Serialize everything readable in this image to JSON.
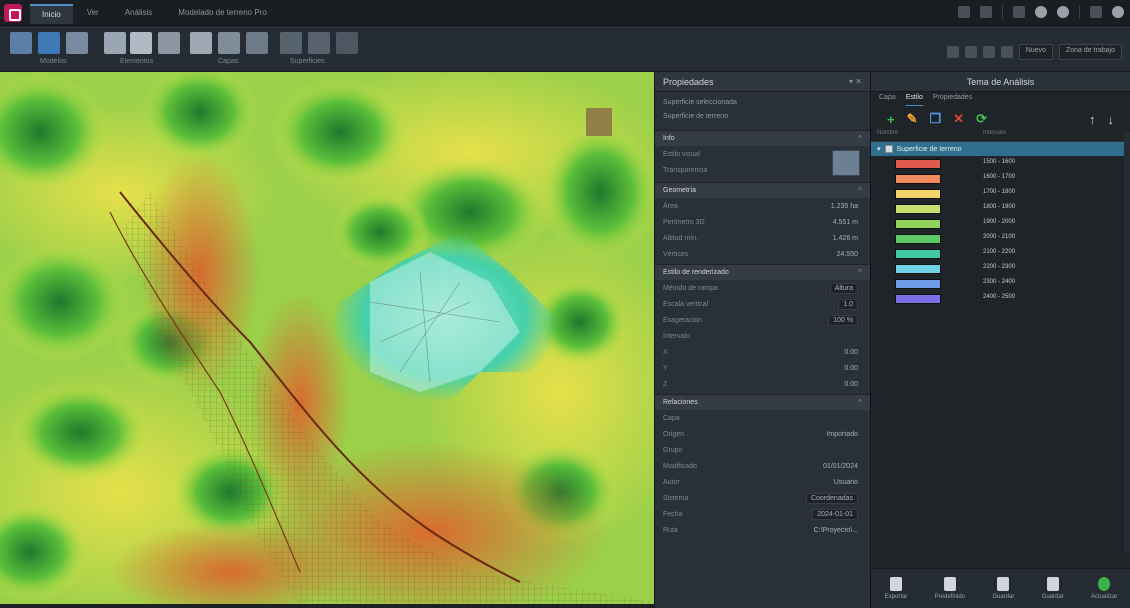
{
  "app": {
    "menu_tabs": [
      "Inicio",
      "Ver",
      "Análisis",
      "Modelado de terreno Pro"
    ],
    "active_tab": 0
  },
  "ribbon": {
    "groups": [
      "Modelos",
      "Elementos",
      "Capas",
      "Superficies"
    ],
    "select1": "Nuevo",
    "select2": "Zona de trabajo"
  },
  "properties": {
    "title": "Propiedades",
    "sub1": "Superficie seleccionada",
    "sub2": "Superficie de terreno",
    "sections": {
      "info": "Info",
      "geometry": "Geometría",
      "style": "Estilo de renderizado",
      "relations": "Relaciones"
    },
    "info_rows": [
      {
        "label": "Estilo visual",
        "value": ""
      },
      {
        "label": "Transparencia",
        "value": ""
      }
    ],
    "geometry_rows": [
      {
        "label": "Área",
        "value": "1.235 ha"
      },
      {
        "label": "Perímetro 3D",
        "value": "4.551 m"
      },
      {
        "label": "Altitud mín.",
        "value": "1.426 m"
      },
      {
        "label": "Vértices",
        "value": "24.550"
      }
    ],
    "style_rows": [
      {
        "label": "Método de rampa",
        "value": "Altura"
      },
      {
        "label": "Escala vertical",
        "value": "1.0"
      },
      {
        "label": "Exageración",
        "value": "100 %"
      },
      {
        "label": "Intervalo",
        "value": ""
      },
      {
        "label": "X",
        "value": "0.00"
      },
      {
        "label": "Y",
        "value": "0.00"
      },
      {
        "label": "Z",
        "value": "0.00"
      }
    ],
    "relation_rows": [
      {
        "label": "Capa",
        "value": ""
      },
      {
        "label": "Origen",
        "value": "Importado"
      },
      {
        "label": "Grupo",
        "value": ""
      },
      {
        "label": "Modificado",
        "value": "01/01/2024"
      },
      {
        "label": "Autor",
        "value": "Usuario"
      },
      {
        "label": "Sistema",
        "value": "Coordenadas"
      },
      {
        "label": "Fecha",
        "value": "2024-01-01"
      },
      {
        "label": "Ruta",
        "value": "C:\\Proyecto\\..."
      }
    ]
  },
  "layers": {
    "title": "Tema de Análisis",
    "tabs": [
      "Capa",
      "Estilo",
      "Propiedades"
    ],
    "col_headers": [
      "Nombre",
      "Intervalo"
    ],
    "root_label": "Superficie de terreno",
    "legend": [
      {
        "color": "#e05a4f",
        "label": "1500 - 1600"
      },
      {
        "color": "#f08a5d",
        "label": "1600 - 1700"
      },
      {
        "color": "#f3d36a",
        "label": "1700 - 1800"
      },
      {
        "color": "#c8e06a",
        "label": "1800 - 1900"
      },
      {
        "color": "#8fd35e",
        "label": "1900 - 2000"
      },
      {
        "color": "#5fc96a",
        "label": "2000 - 2100"
      },
      {
        "color": "#3fc9a6",
        "label": "2100 - 2200"
      },
      {
        "color": "#6fd3e6",
        "label": "2200 - 2300"
      },
      {
        "color": "#6f9be6",
        "label": "2300 - 2400"
      },
      {
        "color": "#7a6fe6",
        "label": "2400 - 2500"
      }
    ],
    "bottom_buttons": [
      "Exportar",
      "Predefinido",
      "Guardar",
      "Guardar",
      "Actualizar"
    ]
  }
}
